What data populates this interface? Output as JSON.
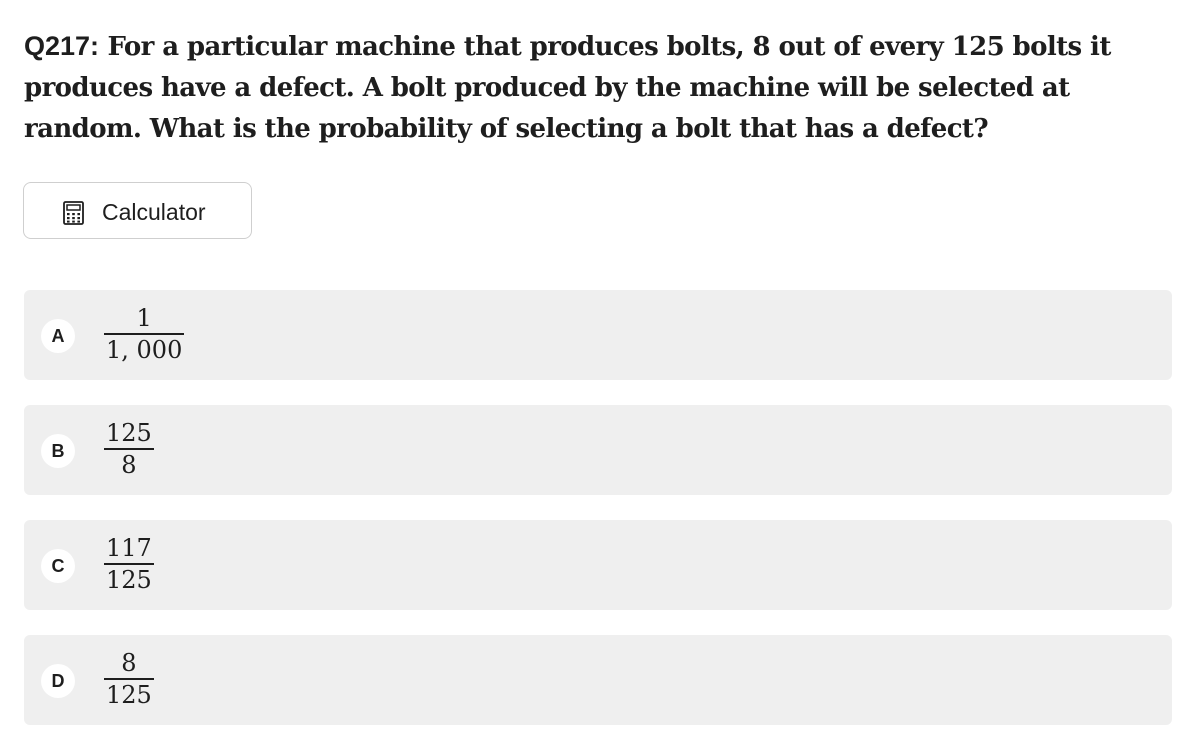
{
  "question": {
    "number": "Q217:",
    "text": " For a particular machine that produces bolts, 8 out of every 125 bolts it produces have a defect. A bolt produced by the machine will be selected at random. What is the probability of selecting a bolt that has a defect?"
  },
  "calculator": {
    "label": "Calculator",
    "icon": "calculator-icon"
  },
  "options": [
    {
      "letter": "A",
      "numerator": "1",
      "denominator": "1, 000"
    },
    {
      "letter": "B",
      "numerator": "125",
      "denominator": "8"
    },
    {
      "letter": "C",
      "numerator": "117",
      "denominator": "125"
    },
    {
      "letter": "D",
      "numerator": "8",
      "denominator": "125"
    }
  ],
  "colors": {
    "option_background": "#efefef",
    "text": "#1e1e1e",
    "button_border": "#cfcfcf"
  }
}
